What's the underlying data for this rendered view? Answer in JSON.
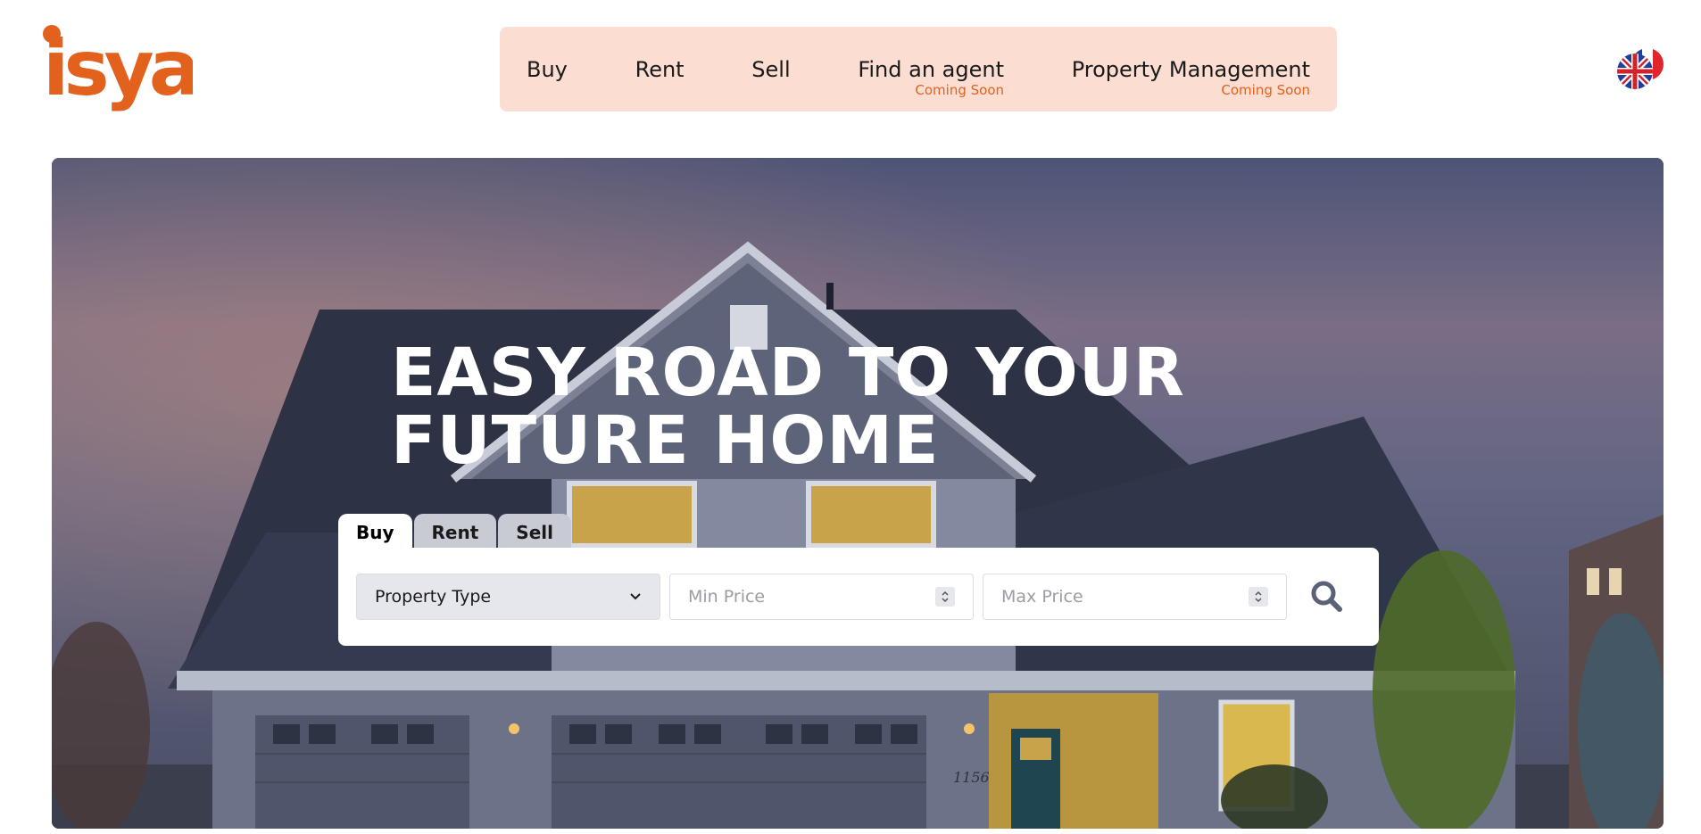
{
  "brand": {
    "logo_text": "isya",
    "accent_color": "#e2611d"
  },
  "nav": {
    "background": "#fbddd2",
    "items": [
      {
        "label": "Buy",
        "note": ""
      },
      {
        "label": "Rent",
        "note": ""
      },
      {
        "label": "Sell",
        "note": ""
      },
      {
        "label": "Find an agent",
        "note": "Coming Soon"
      },
      {
        "label": "Property Management",
        "note": "Coming Soon"
      }
    ]
  },
  "language": {
    "icon": "uk-france-flag-icon"
  },
  "hero": {
    "title_line1": "EASY ROAD TO YOUR",
    "title_line2": "FUTURE HOME",
    "house_number": "1156"
  },
  "search": {
    "tabs": [
      {
        "label": "Buy",
        "active": true
      },
      {
        "label": "Rent",
        "active": false
      },
      {
        "label": "Sell",
        "active": false
      }
    ],
    "property_type": {
      "selected": "Property Type"
    },
    "min_price": {
      "placeholder": "Min Price"
    },
    "max_price": {
      "placeholder": "Max Price"
    },
    "search_icon": "search-icon"
  }
}
